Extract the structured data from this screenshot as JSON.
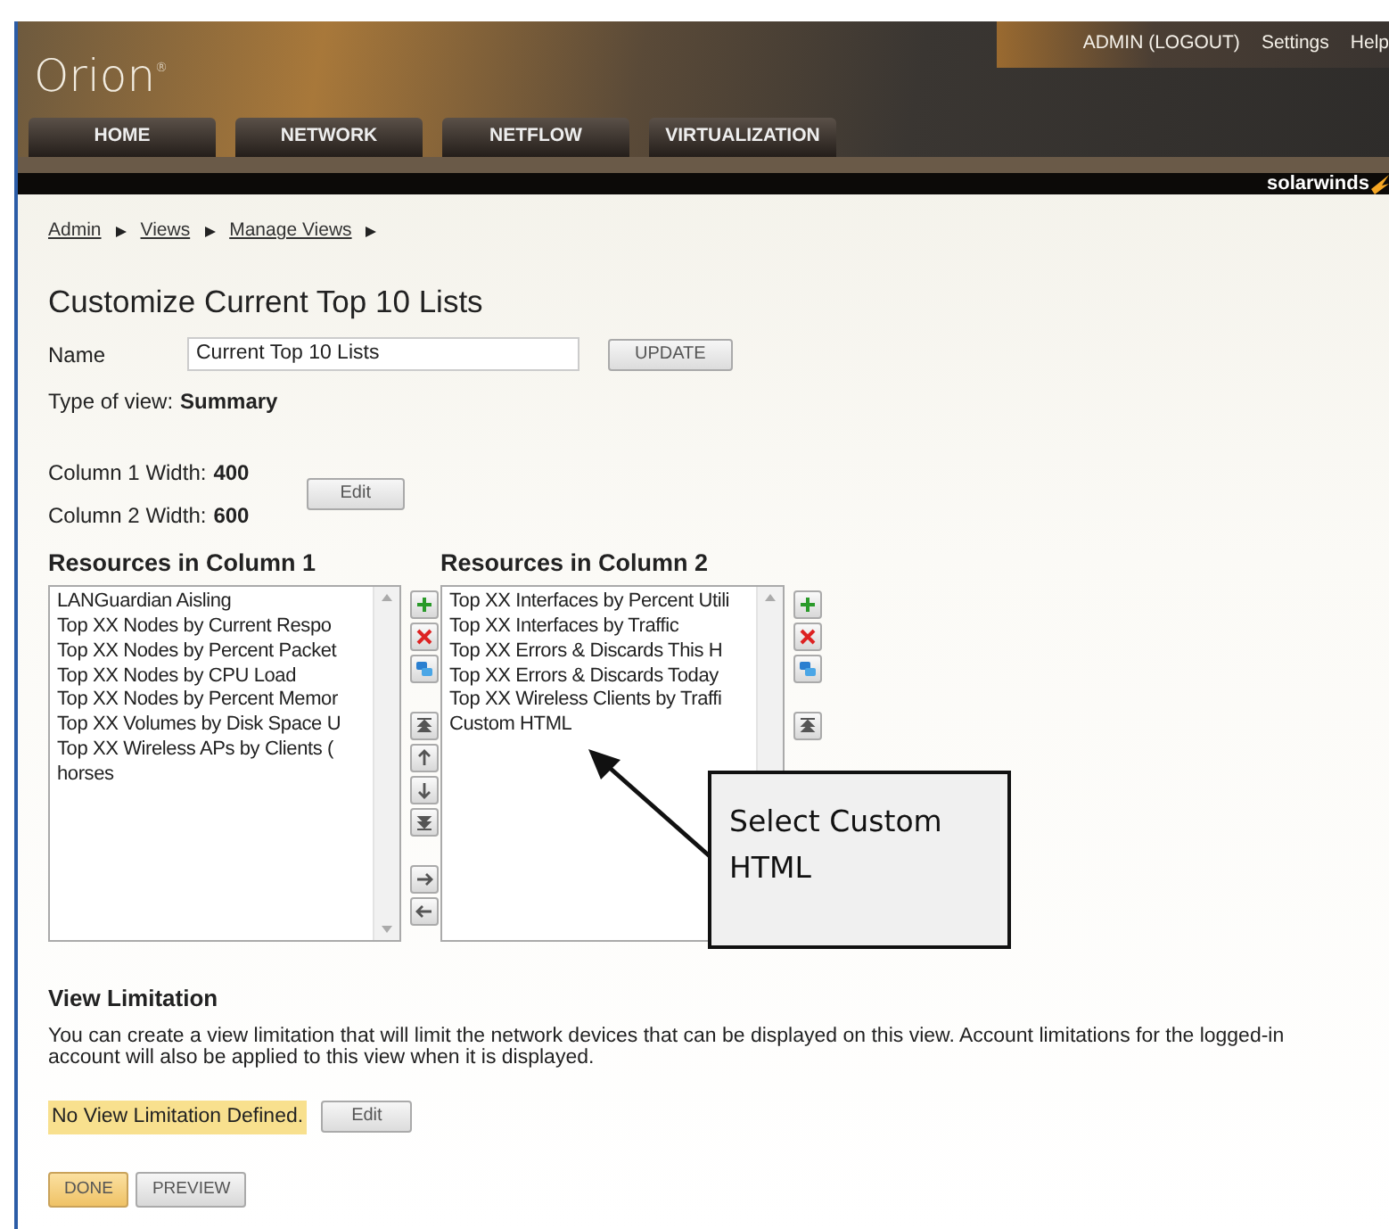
{
  "header": {
    "logo": "Orion",
    "logo_mark": "®",
    "user_links": [
      "ADMIN (LOGOUT)",
      "Settings",
      "Help"
    ],
    "tabs": [
      {
        "label": "HOME"
      },
      {
        "label": "NETWORK"
      },
      {
        "label": "NETFLOW"
      },
      {
        "label": "VIRTUALIZATION"
      }
    ],
    "brand": "solarwinds"
  },
  "breadcrumb": [
    "Admin",
    "Views",
    "Manage Views"
  ],
  "title": "Customize Current Top 10 Lists",
  "name_field": {
    "label": "Name",
    "value": "Current Top 10 Lists",
    "button": "UPDATE"
  },
  "type_of_view": {
    "label": "Type of view:",
    "value": "Summary"
  },
  "column_widths": [
    {
      "label": "Column 1 Width:",
      "value": "400"
    },
    {
      "label": "Column 2 Width:",
      "value": "600"
    }
  ],
  "column_widths_button": "Edit",
  "columns": [
    {
      "heading": "Resources in Column 1",
      "items": [
        "LANGuardian Aisling",
        "Top XX Nodes by Current Respo",
        "Top XX Nodes by Percent Packet",
        "Top XX Nodes by CPU Load",
        "Top XX Nodes by Percent Memor",
        "Top XX Volumes by Disk Space U",
        "Top XX Wireless APs by Clients (",
        "horses"
      ],
      "tools": [
        {
          "kind": "add"
        },
        {
          "kind": "remove"
        },
        {
          "kind": "copy"
        },
        {
          "kind": "gap"
        },
        {
          "kind": "top"
        },
        {
          "kind": "up"
        },
        {
          "kind": "down"
        },
        {
          "kind": "bottom"
        },
        {
          "kind": "gap"
        },
        {
          "kind": "right"
        },
        {
          "kind": "left"
        }
      ]
    },
    {
      "heading": "Resources in Column 2",
      "items": [
        "Top XX Interfaces by Percent Utili",
        "Top XX Interfaces by Traffic",
        "Top XX Errors & Discards This H",
        "Top XX Errors & Discards Today",
        "Top XX Wireless Clients by Traffi",
        "Custom HTML"
      ],
      "tools": [
        {
          "kind": "add"
        },
        {
          "kind": "remove"
        },
        {
          "kind": "copy"
        },
        {
          "kind": "gap"
        },
        {
          "kind": "top"
        }
      ]
    }
  ],
  "view_limitation": {
    "heading": "View Limitation",
    "description": "You can create a view limitation that will limit the network devices that can be displayed on this view. Account limitations for the logged-in account will also be applied to this view when it is displayed.",
    "status": "No View Limitation Defined.",
    "button": "Edit"
  },
  "actions": [
    {
      "label": "DONE",
      "primary": true
    },
    {
      "label": "PREVIEW",
      "primary": false
    }
  ],
  "callout": {
    "text": "Select Custom HTML"
  }
}
